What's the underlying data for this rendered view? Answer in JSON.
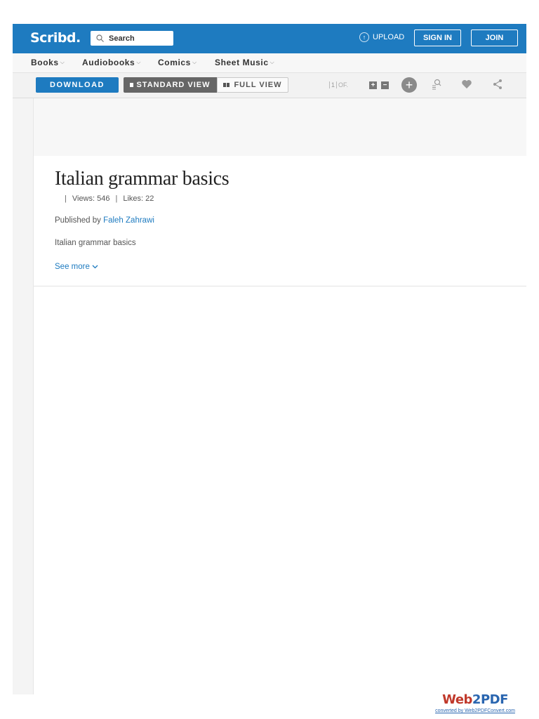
{
  "header": {
    "logo": "Scribd.",
    "search_placeholder": "Search",
    "upload_label": "UPLOAD",
    "signin_label": "SIGN IN",
    "join_label": "JOIN"
  },
  "nav": {
    "items": [
      {
        "label": "Books"
      },
      {
        "label": "Audiobooks"
      },
      {
        "label": "Comics"
      },
      {
        "label": "Sheet Music"
      }
    ]
  },
  "toolbar": {
    "download_label": "DOWNLOAD",
    "standard_view_label": "STANDARD VIEW",
    "full_view_label": "FULL VIEW",
    "page_current": "1",
    "page_of": "OF."
  },
  "document": {
    "title": "Italian grammar basics",
    "views": "Views: 546",
    "likes": "Likes: 22",
    "published_prefix": "Published by",
    "author": "Faleh Zahrawi",
    "description": "Italian grammar basics",
    "see_more": "See more"
  },
  "watermark": {
    "brand_a": "Web",
    "brand_b": "2PDF",
    "subtitle": "converted by Web2PDFConvert.com"
  },
  "colors": {
    "brand_blue": "#1e7bc0",
    "watermark_red": "#c0392b"
  }
}
